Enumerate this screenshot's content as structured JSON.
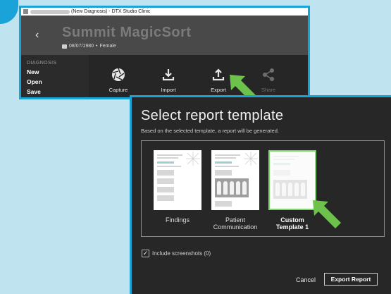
{
  "window": {
    "title": "(New Diagnosis) - DTX Studio Clinic",
    "patient_name": "Summit MagicSort",
    "patient_dob": "08/07/1980",
    "patient_gender": "Female",
    "separator": "•"
  },
  "sidebar": {
    "section": "DIAGNOSIS",
    "items": [
      "New",
      "Open",
      "Save"
    ]
  },
  "toolbar": {
    "tools": [
      {
        "label": "Capture",
        "icon": "aperture-icon",
        "enabled": true
      },
      {
        "label": "Import",
        "icon": "import-icon",
        "enabled": true
      },
      {
        "label": "Export",
        "icon": "export-icon",
        "enabled": true
      },
      {
        "label": "Share",
        "icon": "share-icon",
        "enabled": false
      }
    ]
  },
  "dialog": {
    "title": "Select report template",
    "subtitle": "Based on the selected template, a report will be generated.",
    "templates": [
      {
        "line1": "Findings",
        "line2": ""
      },
      {
        "line1": "Patient",
        "line2": "Communication"
      },
      {
        "line1": "Custom",
        "line2": "Template 1",
        "selected": true
      }
    ],
    "include_screenshots": "Include screenshots (0)",
    "include_checked": true,
    "cancel_label": "Cancel",
    "export_label": "Export Report"
  },
  "colors": {
    "highlight_border": "#1aa3d8",
    "pointer_arrow": "#6cc24a",
    "selected_template": "#7dd86a"
  }
}
